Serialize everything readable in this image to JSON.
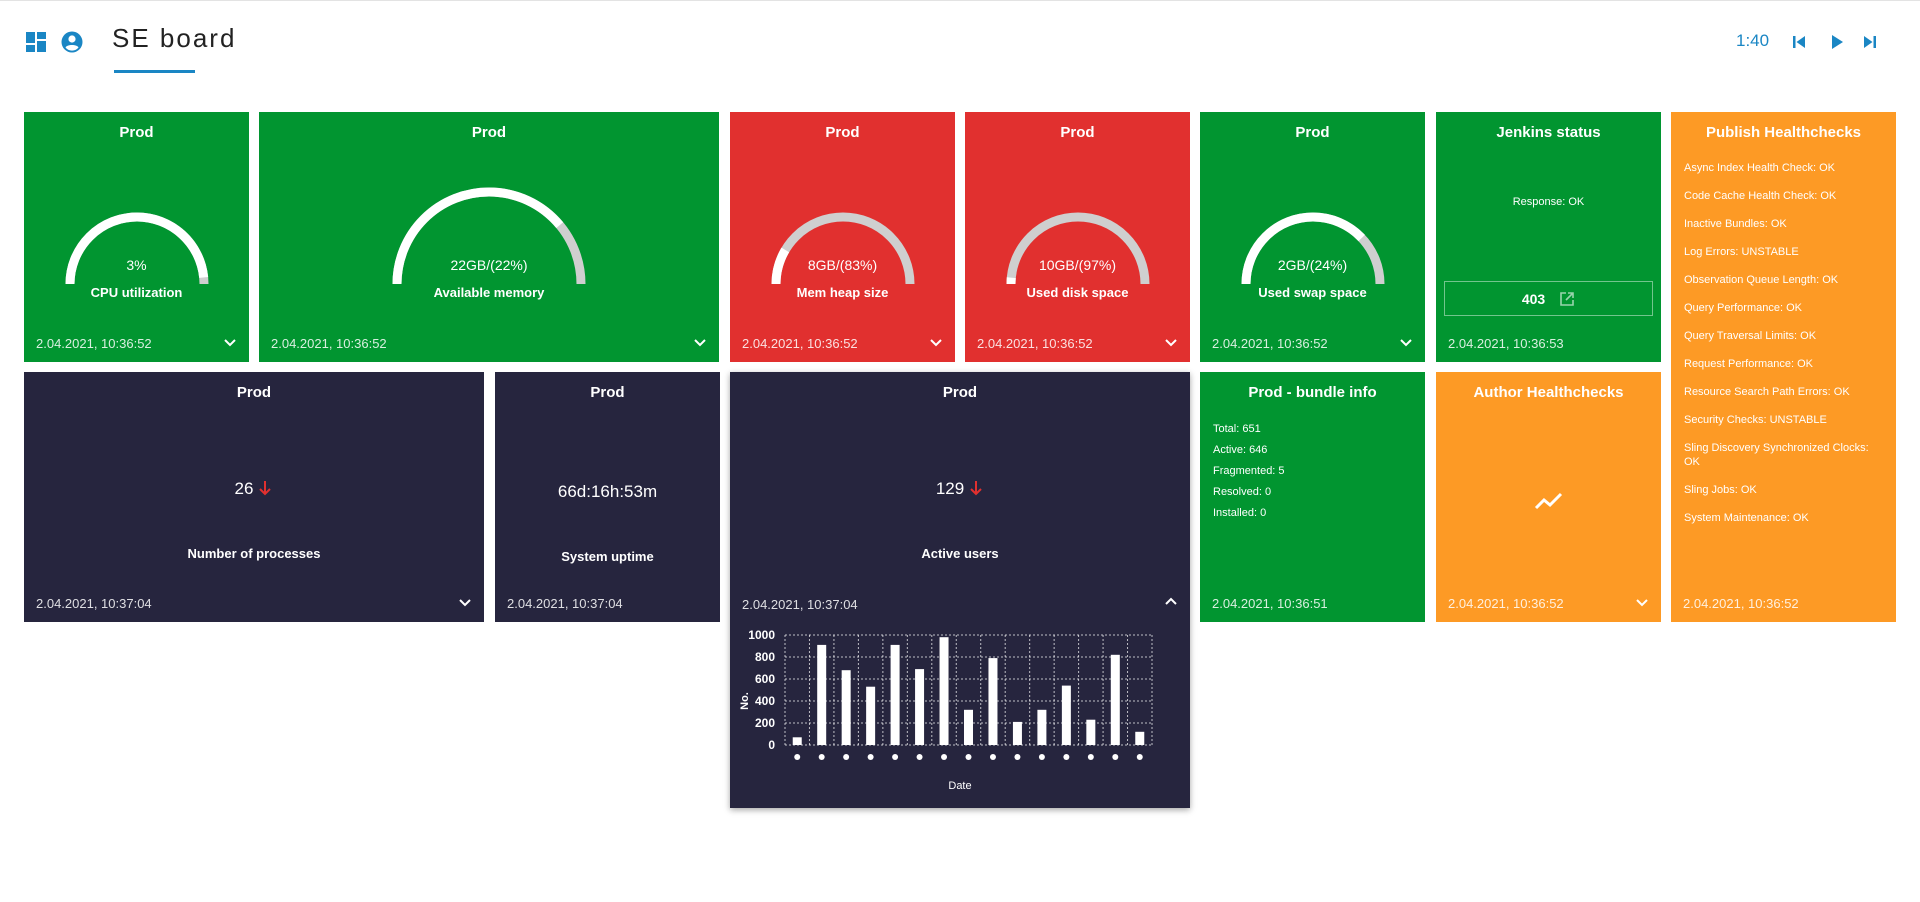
{
  "header": {
    "title": "SE board",
    "timer": "1:40",
    "icons": [
      "dashboard-icon",
      "account-circle-icon",
      "skip-previous-icon",
      "play-icon",
      "skip-next-icon"
    ]
  },
  "colors": {
    "ok": "#019530",
    "critical": "#e1302f",
    "info": "#26253e",
    "warning": "#fd9a25",
    "accent": "#1a86c4"
  },
  "tiles": {
    "cpu": {
      "title": "Prod",
      "value": "3%",
      "label": "CPU utilization",
      "timestamp": "2.04.2021, 10:36:52",
      "percent": 3
    },
    "memory": {
      "title": "Prod",
      "value": "22GB/(22%)",
      "label": "Available memory",
      "timestamp": "2.04.2021, 10:36:52",
      "percent": 22
    },
    "heap": {
      "title": "Prod",
      "value": "8GB/(83%)",
      "label": "Mem heap size",
      "timestamp": "2.04.2021, 10:36:52",
      "percent": 83
    },
    "disk": {
      "title": "Prod",
      "value": "10GB/(97%)",
      "label": "Used disk space",
      "timestamp": "2.04.2021, 10:36:52",
      "percent": 97
    },
    "swap": {
      "title": "Prod",
      "value": "2GB/(24%)",
      "label": "Used swap space",
      "timestamp": "2.04.2021, 10:36:52",
      "percent": 24
    },
    "jenkins": {
      "title": "Jenkins status",
      "response": "Response: OK",
      "code": "403",
      "timestamp": "2.04.2021, 10:36:53"
    },
    "publish": {
      "title": "Publish Healthchecks",
      "items": [
        "Async Index Health Check: OK",
        "Code Cache Health Check: OK",
        "Inactive Bundles: OK",
        "Log Errors: UNSTABLE",
        "Observation Queue Length: OK",
        "Query Performance: OK",
        "Query Traversal Limits: OK",
        "Request Performance: OK",
        "Resource Search Path Errors: OK",
        "Security Checks: UNSTABLE",
        "Sling Discovery Synchronized Clocks: OK",
        "Sling Jobs: OK",
        "System Maintenance: OK"
      ],
      "timestamp": "2.04.2021, 10:36:52"
    },
    "processes": {
      "title": "Prod",
      "value": "26",
      "label": "Number of processes",
      "timestamp": "2.04.2021, 10:37:04"
    },
    "uptime": {
      "title": "Prod",
      "value": "66d:16h:53m",
      "label": "System uptime",
      "timestamp": "2.04.2021, 10:37:04"
    },
    "users": {
      "title": "Prod",
      "value": "129",
      "label": "Active users",
      "timestamp": "2.04.2021, 10:37:04"
    },
    "bundle": {
      "title": "Prod - bundle info",
      "items": [
        "Total: 651",
        "Active: 646",
        "Fragmented: 5",
        "Resolved: 0",
        "Installed: 0"
      ],
      "timestamp": "2.04.2021, 10:36:51"
    },
    "author": {
      "title": "Author Healthchecks",
      "timestamp": "2.04.2021, 10:36:52"
    }
  },
  "chart_data": {
    "type": "bar",
    "categories": [
      "",
      "",
      "",
      "",
      "",
      "",
      "",
      "",
      "",
      "",
      "",
      "",
      "",
      "",
      ""
    ],
    "values": [
      70,
      910,
      680,
      530,
      910,
      690,
      980,
      320,
      790,
      210,
      320,
      540,
      230,
      820,
      120
    ],
    "xlabel": "Date",
    "ylabel": "No.",
    "yticks": [
      0,
      200,
      400,
      600,
      800,
      1000
    ],
    "ylim": [
      0,
      1000
    ],
    "grid": true,
    "bar_color": "#ffffff"
  }
}
